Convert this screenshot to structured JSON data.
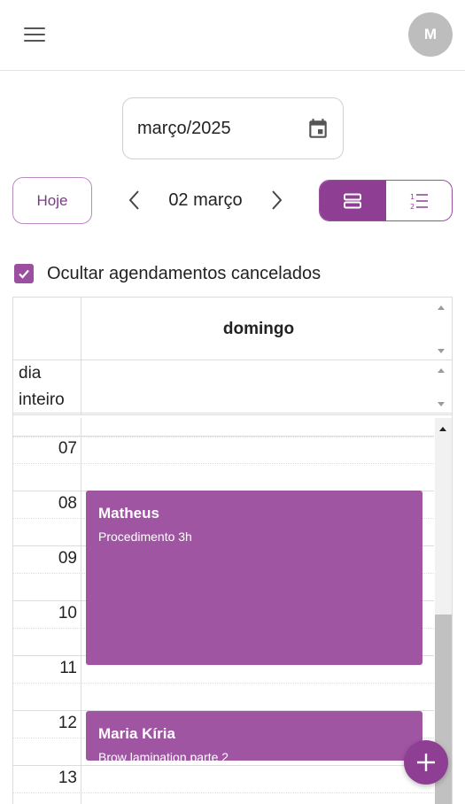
{
  "header": {
    "avatar_initial": "M"
  },
  "date_picker": {
    "value": "março/2025"
  },
  "toolbar": {
    "today_label": "Hoje",
    "day_label": "02 março"
  },
  "filter": {
    "hide_cancelled_label": "Ocultar agendamentos cancelados",
    "checked": true
  },
  "calendar": {
    "day_header": "domingo",
    "allday_label_line1": "dia",
    "allday_label_line2": "inteiro",
    "hours": [
      "07",
      "08",
      "09",
      "10",
      "11",
      "12",
      "13"
    ],
    "events": [
      {
        "title": "Matheus",
        "subtitle": "Procedimento 3h"
      },
      {
        "title": "Maria Kíria",
        "subtitle": "Brow lamination parte 2"
      }
    ]
  },
  "colors": {
    "accent": "#8e3f93",
    "event": "#a055a3",
    "avatar": "#bdbdbd"
  },
  "icons": {
    "menu": "hamburger-icon",
    "date": "calendar-icon",
    "prev": "chevron-left-icon",
    "next": "chevron-right-icon",
    "day_view": "day-view-icon",
    "list_view": "numbered-list-icon",
    "add": "plus-icon"
  }
}
